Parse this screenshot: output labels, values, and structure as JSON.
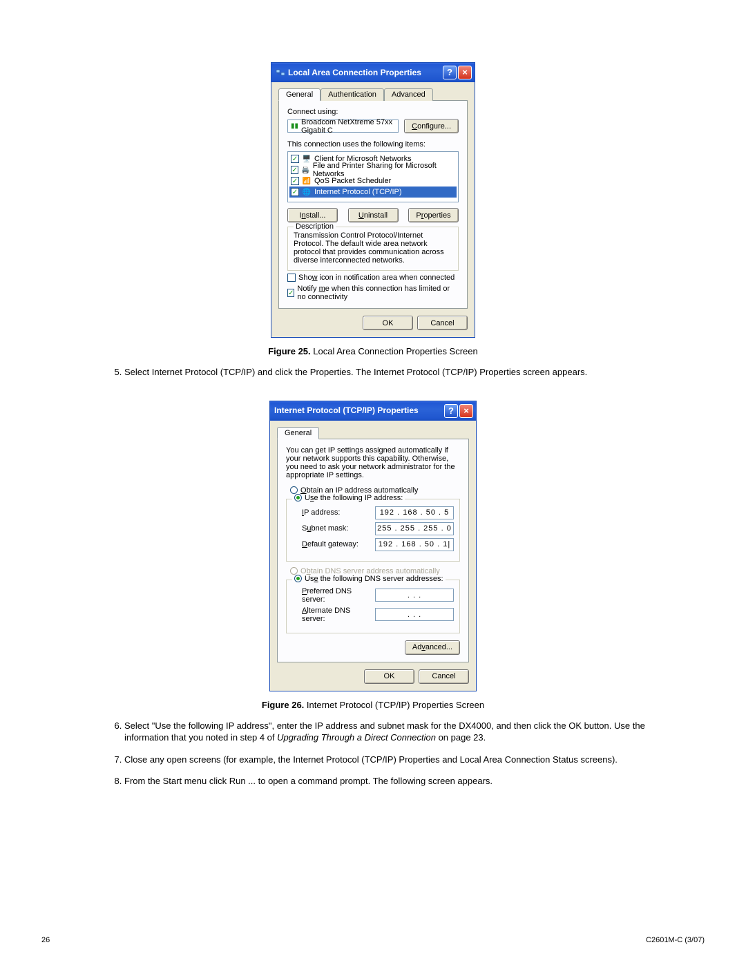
{
  "dialog1": {
    "title": "Local Area Connection Properties",
    "tabs": {
      "general": "General",
      "auth": "Authentication",
      "advanced": "Advanced"
    },
    "connect_using_label": "Connect using:",
    "nic_name": "Broadcom NetXtreme 57xx Gigabit C",
    "configure_btn": "Configure...",
    "items_label": "This connection uses the following items:",
    "items": {
      "i0": "Client for Microsoft Networks",
      "i1": "File and Printer Sharing for Microsoft Networks",
      "i2": "QoS Packet Scheduler",
      "i3": "Internet Protocol (TCP/IP)"
    },
    "install_btn": "Install...",
    "uninstall_btn": "Uninstall",
    "properties_btn": "Properties",
    "desc_legend": "Description",
    "desc_text": "Transmission Control Protocol/Internet Protocol. The default wide area network protocol that provides communication across diverse interconnected networks.",
    "show_icon": "Show icon in notification area when connected",
    "notify": "Notify me when this connection has limited or no connectivity",
    "ok": "OK",
    "cancel": "Cancel"
  },
  "caption1": {
    "bold": "Figure 25.",
    "text": " Local Area Connection Properties Screen"
  },
  "step5": "Select Internet Protocol (TCP/IP) and click the Properties. The Internet Protocol (TCP/IP) Properties screen appears.",
  "dialog2": {
    "title": "Internet Protocol (TCP/IP) Properties",
    "tabs": {
      "general": "General"
    },
    "intro": "You can get IP settings assigned automatically if your network supports this capability. Otherwise, you need to ask your network administrator for the appropriate IP settings.",
    "r_auto_ip": "Obtain an IP address automatically",
    "r_manual_ip": "Use the following IP address:",
    "ip_addr_lbl": "IP address:",
    "ip_addr_val": "192 . 168 .  50 .   5",
    "subnet_lbl": "Subnet mask:",
    "subnet_val": "255 . 255 . 255 .   0",
    "gw_lbl": "Default gateway:",
    "gw_val": "192 . 168 .  50 .   1|",
    "r_auto_dns": "Obtain DNS server address automatically",
    "r_manual_dns": "Use the following DNS server addresses:",
    "pref_dns_lbl": "Preferred DNS server:",
    "pref_dns_val": ".       .       .",
    "alt_dns_lbl": "Alternate DNS server:",
    "alt_dns_val": ".       .       .",
    "advanced_btn": "Advanced...",
    "ok": "OK",
    "cancel": "Cancel"
  },
  "caption2": {
    "bold": "Figure 26.",
    "text": " Internet Protocol (TCP/IP) Properties Screen"
  },
  "step6_a": "Select \"Use the following IP address\", enter the IP address and subnet mask for the DX4000, and then click the OK button. Use the information that you noted in step 4 of ",
  "step6_i": "Upgrading Through a Direct Connection",
  "step6_b": " on page 23.",
  "step7": "Close any open screens (for example, the Internet Protocol (TCP/IP) Properties and Local Area Connection Status screens).",
  "step8": "From the Start menu click Run ... to open a command prompt. The following screen appears.",
  "footer": {
    "page": "26",
    "doc": "C2601M-C (3/07)"
  }
}
